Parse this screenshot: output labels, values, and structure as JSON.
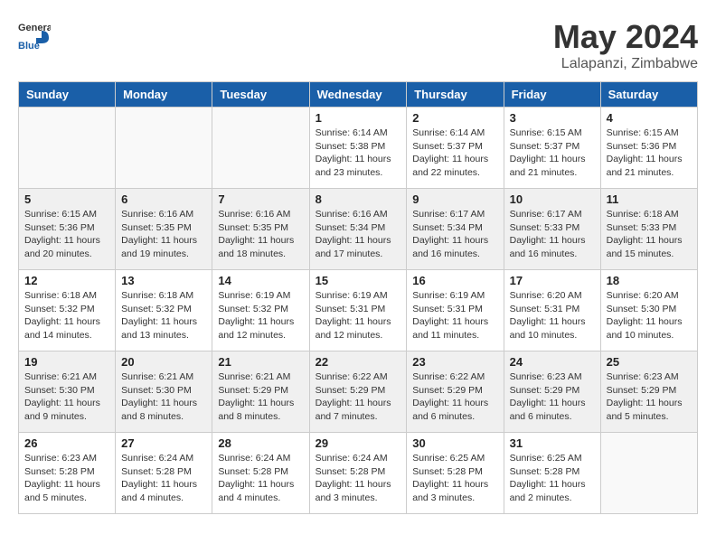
{
  "header": {
    "logo_general": "General",
    "logo_blue": "Blue",
    "title": "May 2024",
    "location": "Lalapanzi, Zimbabwe"
  },
  "weekdays": [
    "Sunday",
    "Monday",
    "Tuesday",
    "Wednesday",
    "Thursday",
    "Friday",
    "Saturday"
  ],
  "weeks": [
    [
      {
        "day": "",
        "info": ""
      },
      {
        "day": "",
        "info": ""
      },
      {
        "day": "",
        "info": ""
      },
      {
        "day": "1",
        "info": "Sunrise: 6:14 AM\nSunset: 5:38 PM\nDaylight: 11 hours\nand 23 minutes."
      },
      {
        "day": "2",
        "info": "Sunrise: 6:14 AM\nSunset: 5:37 PM\nDaylight: 11 hours\nand 22 minutes."
      },
      {
        "day": "3",
        "info": "Sunrise: 6:15 AM\nSunset: 5:37 PM\nDaylight: 11 hours\nand 21 minutes."
      },
      {
        "day": "4",
        "info": "Sunrise: 6:15 AM\nSunset: 5:36 PM\nDaylight: 11 hours\nand 21 minutes."
      }
    ],
    [
      {
        "day": "5",
        "info": "Sunrise: 6:15 AM\nSunset: 5:36 PM\nDaylight: 11 hours\nand 20 minutes."
      },
      {
        "day": "6",
        "info": "Sunrise: 6:16 AM\nSunset: 5:35 PM\nDaylight: 11 hours\nand 19 minutes."
      },
      {
        "day": "7",
        "info": "Sunrise: 6:16 AM\nSunset: 5:35 PM\nDaylight: 11 hours\nand 18 minutes."
      },
      {
        "day": "8",
        "info": "Sunrise: 6:16 AM\nSunset: 5:34 PM\nDaylight: 11 hours\nand 17 minutes."
      },
      {
        "day": "9",
        "info": "Sunrise: 6:17 AM\nSunset: 5:34 PM\nDaylight: 11 hours\nand 16 minutes."
      },
      {
        "day": "10",
        "info": "Sunrise: 6:17 AM\nSunset: 5:33 PM\nDaylight: 11 hours\nand 16 minutes."
      },
      {
        "day": "11",
        "info": "Sunrise: 6:18 AM\nSunset: 5:33 PM\nDaylight: 11 hours\nand 15 minutes."
      }
    ],
    [
      {
        "day": "12",
        "info": "Sunrise: 6:18 AM\nSunset: 5:32 PM\nDaylight: 11 hours\nand 14 minutes."
      },
      {
        "day": "13",
        "info": "Sunrise: 6:18 AM\nSunset: 5:32 PM\nDaylight: 11 hours\nand 13 minutes."
      },
      {
        "day": "14",
        "info": "Sunrise: 6:19 AM\nSunset: 5:32 PM\nDaylight: 11 hours\nand 12 minutes."
      },
      {
        "day": "15",
        "info": "Sunrise: 6:19 AM\nSunset: 5:31 PM\nDaylight: 11 hours\nand 12 minutes."
      },
      {
        "day": "16",
        "info": "Sunrise: 6:19 AM\nSunset: 5:31 PM\nDaylight: 11 hours\nand 11 minutes."
      },
      {
        "day": "17",
        "info": "Sunrise: 6:20 AM\nSunset: 5:31 PM\nDaylight: 11 hours\nand 10 minutes."
      },
      {
        "day": "18",
        "info": "Sunrise: 6:20 AM\nSunset: 5:30 PM\nDaylight: 11 hours\nand 10 minutes."
      }
    ],
    [
      {
        "day": "19",
        "info": "Sunrise: 6:21 AM\nSunset: 5:30 PM\nDaylight: 11 hours\nand 9 minutes."
      },
      {
        "day": "20",
        "info": "Sunrise: 6:21 AM\nSunset: 5:30 PM\nDaylight: 11 hours\nand 8 minutes."
      },
      {
        "day": "21",
        "info": "Sunrise: 6:21 AM\nSunset: 5:29 PM\nDaylight: 11 hours\nand 8 minutes."
      },
      {
        "day": "22",
        "info": "Sunrise: 6:22 AM\nSunset: 5:29 PM\nDaylight: 11 hours\nand 7 minutes."
      },
      {
        "day": "23",
        "info": "Sunrise: 6:22 AM\nSunset: 5:29 PM\nDaylight: 11 hours\nand 6 minutes."
      },
      {
        "day": "24",
        "info": "Sunrise: 6:23 AM\nSunset: 5:29 PM\nDaylight: 11 hours\nand 6 minutes."
      },
      {
        "day": "25",
        "info": "Sunrise: 6:23 AM\nSunset: 5:29 PM\nDaylight: 11 hours\nand 5 minutes."
      }
    ],
    [
      {
        "day": "26",
        "info": "Sunrise: 6:23 AM\nSunset: 5:28 PM\nDaylight: 11 hours\nand 5 minutes."
      },
      {
        "day": "27",
        "info": "Sunrise: 6:24 AM\nSunset: 5:28 PM\nDaylight: 11 hours\nand 4 minutes."
      },
      {
        "day": "28",
        "info": "Sunrise: 6:24 AM\nSunset: 5:28 PM\nDaylight: 11 hours\nand 4 minutes."
      },
      {
        "day": "29",
        "info": "Sunrise: 6:24 AM\nSunset: 5:28 PM\nDaylight: 11 hours\nand 3 minutes."
      },
      {
        "day": "30",
        "info": "Sunrise: 6:25 AM\nSunset: 5:28 PM\nDaylight: 11 hours\nand 3 minutes."
      },
      {
        "day": "31",
        "info": "Sunrise: 6:25 AM\nSunset: 5:28 PM\nDaylight: 11 hours\nand 2 minutes."
      },
      {
        "day": "",
        "info": ""
      }
    ]
  ]
}
